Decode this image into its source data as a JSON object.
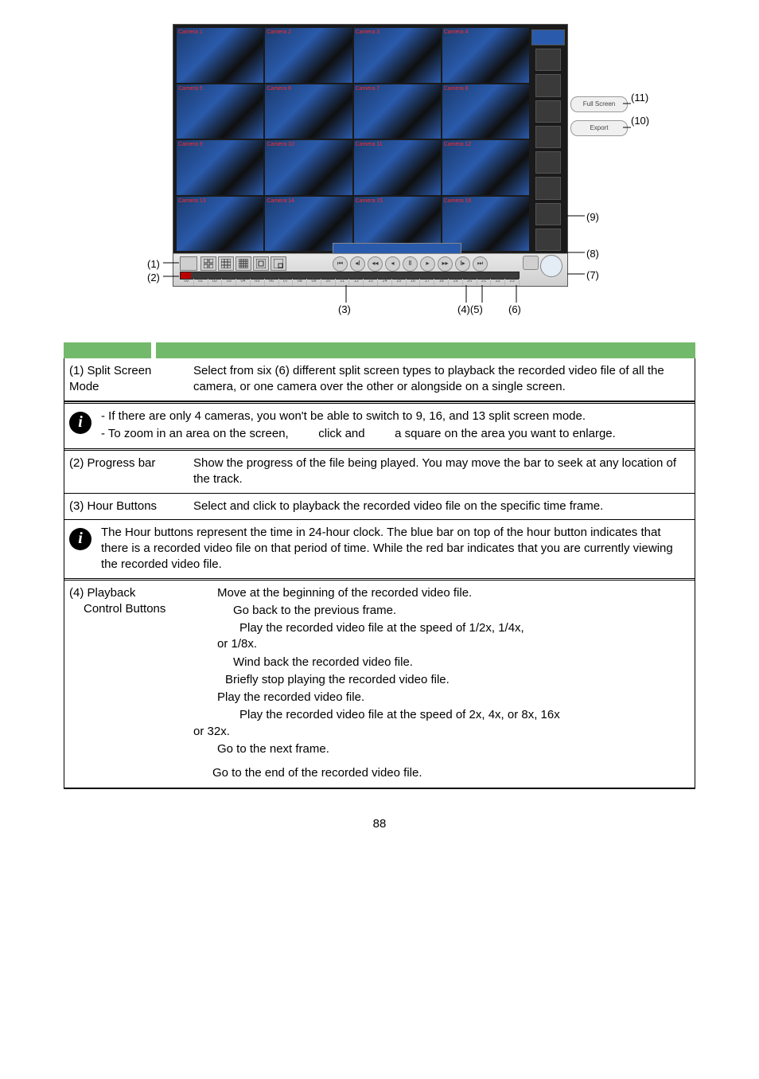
{
  "callouts": {
    "c1": "(1)",
    "c2": "(2)",
    "c3": "(3)",
    "c4": "(4)",
    "c5": "(5)",
    "c6": "(6)",
    "c7": "(7)",
    "c8": "(8)",
    "c9": "(9)",
    "c10": "(10)",
    "c11": "(11)",
    "c45": "(4)(5)"
  },
  "pill_fullscreen": "Full Screen",
  "pill_export": "Export",
  "tile_prefix": "Camera ",
  "row1": {
    "label": "(1) Split Screen Mode",
    "body": "Select from six (6) different split screen types to playback the recorded video file of all the camera, or one camera over the other or alongside on a single screen."
  },
  "info1": {
    "li1": "If there are only 4 cameras, you won't be able to switch to 9, 16, and 13 split screen mode.",
    "li2_a": "To zoom in an area on the screen,",
    "li2_b": "click and",
    "li2_c": "a square on the area you want to enlarge."
  },
  "row2": {
    "label": "(2) Progress bar",
    "body": "Show the progress of the file being played. You may move the bar to seek at any location of the track."
  },
  "row3": {
    "label": "(3) Hour Buttons",
    "body": "Select and click to playback the recorded video file on the specific time frame."
  },
  "info2": "The Hour buttons represent the time in 24-hour clock. The blue bar on top of the hour button indicates that there is a recorded video file on that period of time. While the red bar indicates that you are currently viewing the recorded video file.",
  "row4": {
    "label1": "(4) Playback",
    "label2": "Control Buttons",
    "l1": "Move at the beginning of the recorded video file.",
    "l2": "Go back to the previous frame.",
    "l3_a": "Play the recorded video file at the speed of 1/2x, 1/4x,",
    "l3_b": "or 1/8x.",
    "l4": "Wind back the recorded video file.",
    "l5": "Briefly stop playing the recorded video file.",
    "l6": "Play the recorded video file.",
    "l7_a": "Play the recorded video file at the speed of 2x, 4x, or 8x, 16x",
    "l7_b": "or 32x.",
    "l8": "Go to the next frame.",
    "l9": "Go to the end of the recorded video file."
  },
  "page_num": "88"
}
